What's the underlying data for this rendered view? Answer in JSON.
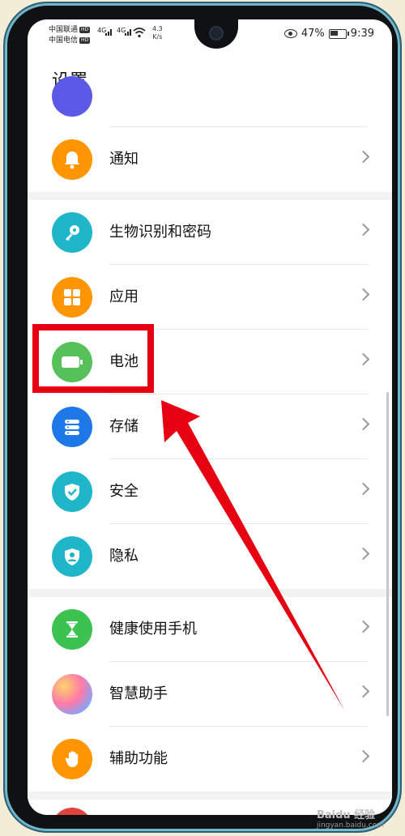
{
  "status": {
    "carrier1": "中国联通",
    "carrier1_badge": "HD",
    "carrier2": "中国电信",
    "carrier2_badge": "HD",
    "net1": "4G",
    "net2": "4G",
    "speed_value": "4.3",
    "speed_unit": "K/s",
    "battery": "47%",
    "time": "9:39"
  },
  "page": {
    "title": "设置"
  },
  "items": [
    {
      "label": "通知",
      "icon": "bell-icon",
      "color": "#ff9500"
    },
    {
      "label": "生物识别和密码",
      "icon": "key-icon",
      "color": "#1fb6c9"
    },
    {
      "label": "应用",
      "icon": "apps-grid-icon",
      "color": "#ff9500"
    },
    {
      "label": "电池",
      "icon": "battery-icon",
      "color": "#56c15a"
    },
    {
      "label": "存储",
      "icon": "storage-icon",
      "color": "#1e78e8"
    },
    {
      "label": "安全",
      "icon": "shield-check-icon",
      "color": "#1fb6c9"
    },
    {
      "label": "隐私",
      "icon": "privacy-icon",
      "color": "#1fb6c9"
    },
    {
      "label": "健康使用手机",
      "icon": "hourglass-icon",
      "color": "#3cc251"
    },
    {
      "label": "智慧助手",
      "icon": "assistant-icon",
      "color": "#b58cff"
    },
    {
      "label": "辅助功能",
      "icon": "hand-icon",
      "color": "#ff9500"
    }
  ],
  "watermark": {
    "brand": "Baidu 经验",
    "site": "jingyan.baidu.com"
  },
  "annotation": {
    "color": "#e60012"
  }
}
